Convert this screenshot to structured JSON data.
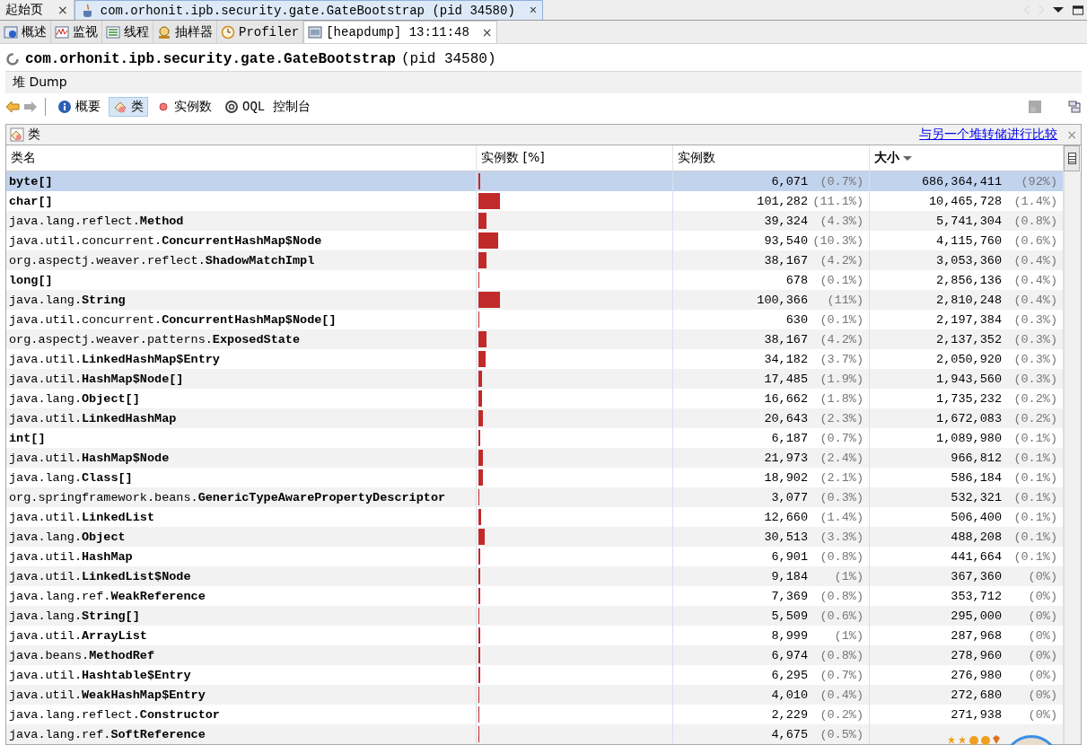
{
  "doc_tabs": [
    {
      "label": "起始页",
      "close": "×",
      "selected": false
    },
    {
      "label": "com.orhonit.ipb.security.gate.GateBootstrap (pid 34580)",
      "close": "×",
      "selected": true
    }
  ],
  "view_tabs": [
    {
      "label": "概述",
      "selected": false
    },
    {
      "label": "监视",
      "selected": false
    },
    {
      "label": "线程",
      "selected": false
    },
    {
      "label": "抽样器",
      "selected": false
    },
    {
      "label": "Profiler",
      "selected": false
    },
    {
      "label": "[heapdump] 13:11:48",
      "close": "×",
      "selected": true
    }
  ],
  "app_title": {
    "name": "com.orhonit.ipb.security.gate.GateBootstrap",
    "pid": "(pid 34580)"
  },
  "section_title": "堆 Dump",
  "toolbar": [
    {
      "label": "概要",
      "selected": false
    },
    {
      "label": "类",
      "selected": true
    },
    {
      "label": "实例数",
      "selected": false
    },
    {
      "label": "OQL 控制台",
      "selected": false
    }
  ],
  "panel": {
    "title": "类",
    "compare_link": "与另一个堆转储进行比较",
    "close": "×"
  },
  "table": {
    "columns": [
      "类名",
      "实例数 [%]",
      "实例数",
      "大小"
    ],
    "rows": [
      {
        "pkg": "",
        "name": "byte[]",
        "level": 0.007,
        "count": "6,071",
        "count_pct": "(0.7%)",
        "size": "686,364,411",
        "size_pct": "(92%)",
        "selected": true
      },
      {
        "pkg": "",
        "name": "char[]",
        "level": 0.111,
        "count": "101,282",
        "count_pct": "(11.1%)",
        "size": "10,465,728",
        "size_pct": "(1.4%)",
        "selected": false
      },
      {
        "pkg": "java.lang.reflect.",
        "name": "Method",
        "level": 0.043,
        "count": "39,324",
        "count_pct": "(4.3%)",
        "size": "5,741,304",
        "size_pct": "(0.8%)",
        "selected": false
      },
      {
        "pkg": "java.util.concurrent.",
        "name": "ConcurrentHashMap$Node",
        "level": 0.103,
        "count": "93,540",
        "count_pct": "(10.3%)",
        "size": "4,115,760",
        "size_pct": "(0.6%)",
        "selected": false
      },
      {
        "pkg": "org.aspectj.weaver.reflect.",
        "name": "ShadowMatchImpl",
        "level": 0.042,
        "count": "38,167",
        "count_pct": "(4.2%)",
        "size": "3,053,360",
        "size_pct": "(0.4%)",
        "selected": false
      },
      {
        "pkg": "",
        "name": "long[]",
        "level": 0.001,
        "count": "678",
        "count_pct": "(0.1%)",
        "size": "2,856,136",
        "size_pct": "(0.4%)",
        "selected": false
      },
      {
        "pkg": "java.lang.",
        "name": "String",
        "level": 0.11,
        "count": "100,366",
        "count_pct": "(11%)",
        "size": "2,810,248",
        "size_pct": "(0.4%)",
        "selected": false
      },
      {
        "pkg": "java.util.concurrent.",
        "name": "ConcurrentHashMap$Node[]",
        "level": 0.001,
        "count": "630",
        "count_pct": "(0.1%)",
        "size": "2,197,384",
        "size_pct": "(0.3%)",
        "selected": false
      },
      {
        "pkg": "org.aspectj.weaver.patterns.",
        "name": "ExposedState",
        "level": 0.042,
        "count": "38,167",
        "count_pct": "(4.2%)",
        "size": "2,137,352",
        "size_pct": "(0.3%)",
        "selected": false
      },
      {
        "pkg": "java.util.",
        "name": "LinkedHashMap$Entry",
        "level": 0.037,
        "count": "34,182",
        "count_pct": "(3.7%)",
        "size": "2,050,920",
        "size_pct": "(0.3%)",
        "selected": false
      },
      {
        "pkg": "java.util.",
        "name": "HashMap$Node[]",
        "level": 0.019,
        "count": "17,485",
        "count_pct": "(1.9%)",
        "size": "1,943,560",
        "size_pct": "(0.3%)",
        "selected": false
      },
      {
        "pkg": "java.lang.",
        "name": "Object[]",
        "level": 0.018,
        "count": "16,662",
        "count_pct": "(1.8%)",
        "size": "1,735,232",
        "size_pct": "(0.2%)",
        "selected": false
      },
      {
        "pkg": "java.util.",
        "name": "LinkedHashMap",
        "level": 0.023,
        "count": "20,643",
        "count_pct": "(2.3%)",
        "size": "1,672,083",
        "size_pct": "(0.2%)",
        "selected": false
      },
      {
        "pkg": "",
        "name": "int[]",
        "level": 0.007,
        "count": "6,187",
        "count_pct": "(0.7%)",
        "size": "1,089,980",
        "size_pct": "(0.1%)",
        "selected": false
      },
      {
        "pkg": "java.util.",
        "name": "HashMap$Node",
        "level": 0.024,
        "count": "21,973",
        "count_pct": "(2.4%)",
        "size": "966,812",
        "size_pct": "(0.1%)",
        "selected": false
      },
      {
        "pkg": "java.lang.",
        "name": "Class[]",
        "level": 0.021,
        "count": "18,902",
        "count_pct": "(2.1%)",
        "size": "586,184",
        "size_pct": "(0.1%)",
        "selected": false
      },
      {
        "pkg": "org.springframework.beans.",
        "name": "GenericTypeAwarePropertyDescriptor",
        "level": 0.003,
        "count": "3,077",
        "count_pct": "(0.3%)",
        "size": "532,321",
        "size_pct": "(0.1%)",
        "selected": false
      },
      {
        "pkg": "java.util.",
        "name": "LinkedList",
        "level": 0.014,
        "count": "12,660",
        "count_pct": "(1.4%)",
        "size": "506,400",
        "size_pct": "(0.1%)",
        "selected": false
      },
      {
        "pkg": "java.lang.",
        "name": "Object",
        "level": 0.033,
        "count": "30,513",
        "count_pct": "(3.3%)",
        "size": "488,208",
        "size_pct": "(0.1%)",
        "selected": false
      },
      {
        "pkg": "java.util.",
        "name": "HashMap",
        "level": 0.008,
        "count": "6,901",
        "count_pct": "(0.8%)",
        "size": "441,664",
        "size_pct": "(0.1%)",
        "selected": false
      },
      {
        "pkg": "java.util.",
        "name": "LinkedList$Node",
        "level": 0.01,
        "count": "9,184",
        "count_pct": "(1%)",
        "size": "367,360",
        "size_pct": "(0%)",
        "selected": false
      },
      {
        "pkg": "java.lang.ref.",
        "name": "WeakReference",
        "level": 0.008,
        "count": "7,369",
        "count_pct": "(0.8%)",
        "size": "353,712",
        "size_pct": "(0%)",
        "selected": false
      },
      {
        "pkg": "java.lang.",
        "name": "String[]",
        "level": 0.006,
        "count": "5,509",
        "count_pct": "(0.6%)",
        "size": "295,000",
        "size_pct": "(0%)",
        "selected": false
      },
      {
        "pkg": "java.util.",
        "name": "ArrayList",
        "level": 0.01,
        "count": "8,999",
        "count_pct": "(1%)",
        "size": "287,968",
        "size_pct": "(0%)",
        "selected": false
      },
      {
        "pkg": "java.beans.",
        "name": "MethodRef",
        "level": 0.008,
        "count": "6,974",
        "count_pct": "(0.8%)",
        "size": "278,960",
        "size_pct": "(0%)",
        "selected": false
      },
      {
        "pkg": "java.util.",
        "name": "Hashtable$Entry",
        "level": 0.007,
        "count": "6,295",
        "count_pct": "(0.7%)",
        "size": "276,980",
        "size_pct": "(0%)",
        "selected": false
      },
      {
        "pkg": "java.util.",
        "name": "WeakHashMap$Entry",
        "level": 0.004,
        "count": "4,010",
        "count_pct": "(0.4%)",
        "size": "272,680",
        "size_pct": "(0%)",
        "selected": false
      },
      {
        "pkg": "java.lang.reflect.",
        "name": "Constructor",
        "level": 0.002,
        "count": "2,229",
        "count_pct": "(0.2%)",
        "size": "271,938",
        "size_pct": "(0%)",
        "selected": false
      },
      {
        "pkg": "java.lang.ref.",
        "name": "SoftReference",
        "level": 0.005,
        "count": "4,675",
        "count_pct": "(0.5%)",
        "selected": false
      }
    ]
  }
}
